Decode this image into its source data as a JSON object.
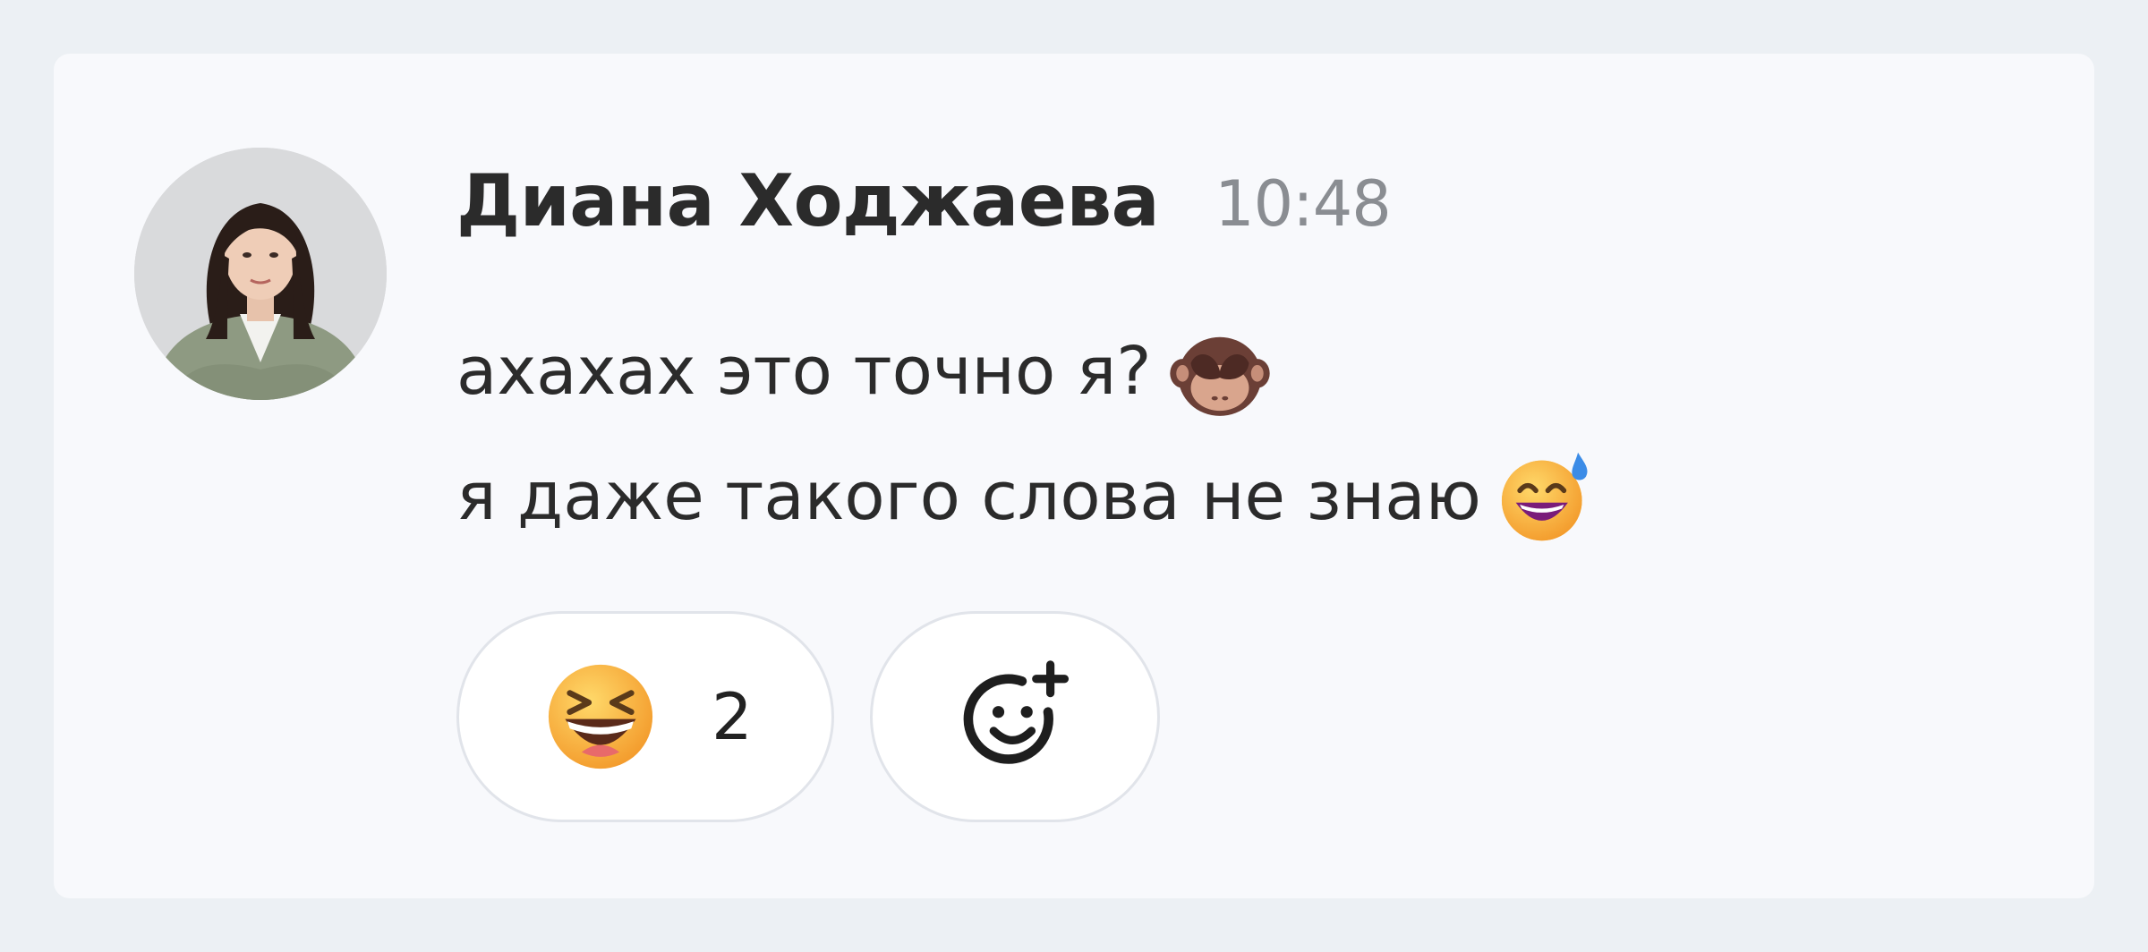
{
  "message": {
    "author": "Диана Ходжаева",
    "time": "10:48",
    "lines": [
      {
        "text": "ахахах это точно я?",
        "emoji": "see-no-evil-monkey-icon"
      },
      {
        "text": "я даже такого слова не знаю",
        "emoji": "grinning-sweat-icon"
      }
    ],
    "avatar": "avatar-photo"
  },
  "reactions": [
    {
      "emoji": "laughing-squinting-face-icon",
      "count": "2"
    }
  ],
  "add_reaction_icon": "add-reaction-icon",
  "colors": {
    "background": "#ecf0f4",
    "card": "#f8f9fc",
    "text": "#2b2b2b",
    "time": "#8a8d92",
    "pill_border": "#e1e4ea"
  }
}
